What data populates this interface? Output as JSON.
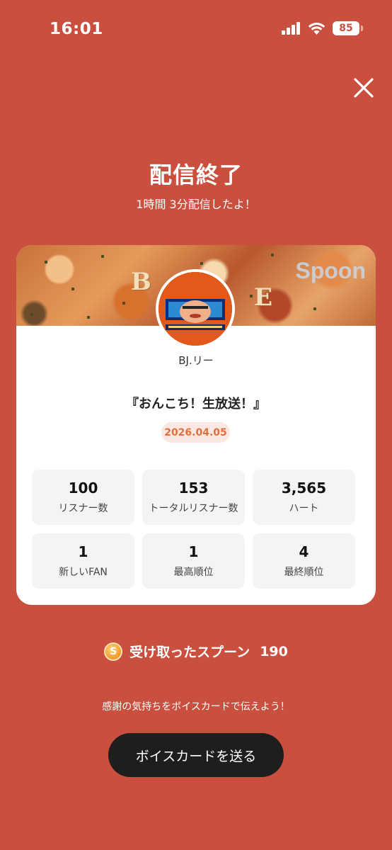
{
  "status_bar": {
    "time": "16:01",
    "battery": "85",
    "icons": [
      "signal-icon",
      "wifi-icon",
      "battery-icon"
    ]
  },
  "header": {
    "title": "配信終了",
    "subtitle": "1時間 3分配信したよ！",
    "close_icon": "close-icon"
  },
  "card": {
    "cover_letters": [
      "B",
      "E"
    ],
    "brand": "Spoon",
    "dj_name": "BJ.リー",
    "show_title": "『おんこち！生放送！』",
    "date": "2026.04.05",
    "stats": [
      {
        "value": "100",
        "label": "リスナー数"
      },
      {
        "value": "153",
        "label": "トータルリスナー数"
      },
      {
        "value": "3,565",
        "label": "ハート"
      },
      {
        "value": "1",
        "label": "新しいFAN"
      },
      {
        "value": "1",
        "label": "最高順位"
      },
      {
        "value": "4",
        "label": "最終順位"
      }
    ]
  },
  "spoons": {
    "icon": "coin-icon",
    "coin_letter": "S",
    "label": "受け取ったスプーン",
    "value": "190"
  },
  "footer": {
    "thanks_text": "感謝の気持ちをボイスカードで伝えよう！",
    "voice_card_button": "ボイスカードを送る"
  },
  "colors": {
    "background": "#C94F3E",
    "date_badge_bg": "#FCE8E2",
    "date_badge_text": "#E0703E",
    "button_bg": "#1E1E1E"
  }
}
